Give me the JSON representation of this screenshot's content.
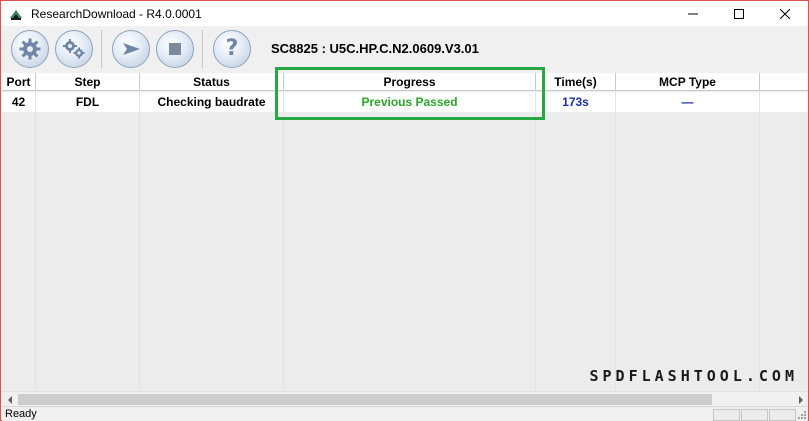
{
  "window": {
    "title": "ResearchDownload - R4.0.0001"
  },
  "toolbar": {
    "buttons": [
      {
        "icon": "gear-icon"
      },
      {
        "icon": "settings-gears-icon"
      },
      {
        "icon": "play-icon"
      },
      {
        "icon": "stop-icon"
      },
      {
        "icon": "help-icon",
        "glyph": "?"
      }
    ],
    "device_label": "SC8825 : U5C.HP.C.N2.0609.V3.01"
  },
  "grid": {
    "columns": [
      "Port",
      "Step",
      "Status",
      "Progress",
      "Time(s)",
      "MCP Type"
    ],
    "rows": [
      {
        "port": "42",
        "step": "FDL",
        "status": "Checking baudrate",
        "progress": "Previous Passed",
        "time": "173s",
        "mcp_type": "—"
      }
    ]
  },
  "colors": {
    "progress_text": "#2aa52a",
    "time_text": "#1c2fa0",
    "mcp_text": "#1c2fa0",
    "highlight_border": "#27a844"
  },
  "statusbar": {
    "text": "Ready"
  },
  "watermark": {
    "text": "SPDFLASHTOOL.COM"
  }
}
